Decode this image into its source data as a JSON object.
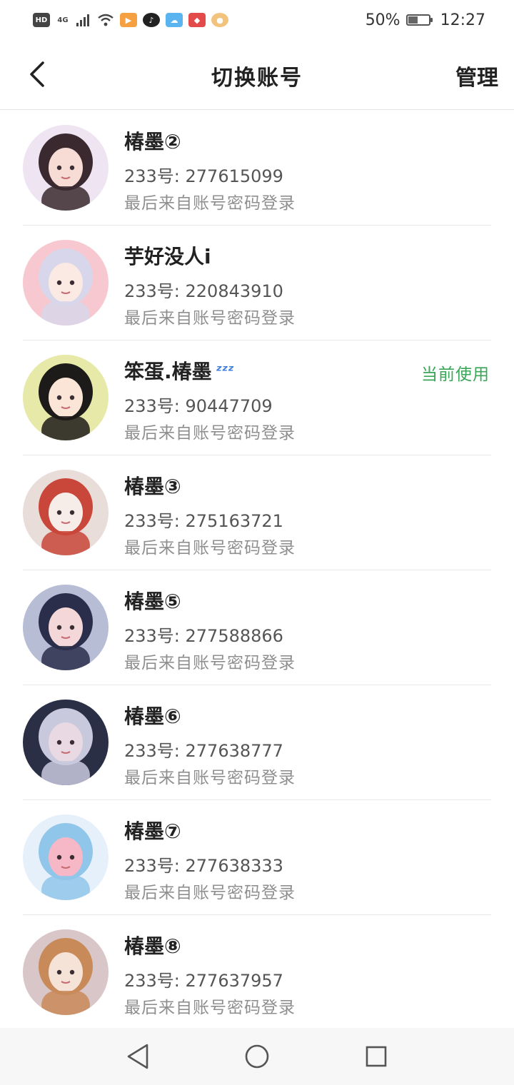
{
  "status_bar": {
    "hd": "HD",
    "network": "4G",
    "battery_text": "50%",
    "battery_level": 0.5,
    "time": "12:27"
  },
  "header": {
    "back_icon": "chevron-left-icon",
    "title": "切换账号",
    "manage_label": "管理"
  },
  "accounts": [
    {
      "name": "椿墨②",
      "id_line": "233号: 277615099",
      "login_line": "最后来自账号密码登录",
      "current": false,
      "palette": [
        "#efe5f2",
        "#3a2a2f",
        "#f7dcd6"
      ]
    },
    {
      "name": "芋好没人i",
      "id_line": "233号: 220843910",
      "login_line": "最后来自账号密码登录",
      "current": false,
      "palette": [
        "#f7c8cf",
        "#d8d6ea",
        "#fbe9e3"
      ]
    },
    {
      "name": "笨蛋.椿墨",
      "id_line": "233号: 90447709",
      "login_line": "最后来自账号密码登录",
      "current": true,
      "current_label": "当前使用",
      "zzz_icon": "zzz-icon",
      "palette": [
        "#e7e9a8",
        "#1d1a1a",
        "#fbe5d6"
      ]
    },
    {
      "name": "椿墨③",
      "id_line": "233号: 275163721",
      "login_line": "最后来自账号密码登录",
      "current": false,
      "palette": [
        "#e8ddd8",
        "#c9473a",
        "#f7ede8"
      ]
    },
    {
      "name": "椿墨⑤",
      "id_line": "233号: 277588866",
      "login_line": "最后来自账号密码登录",
      "current": false,
      "palette": [
        "#b8bdd6",
        "#2a2e4a",
        "#f3d7d9"
      ]
    },
    {
      "name": "椿墨⑥",
      "id_line": "233号: 277638777",
      "login_line": "最后来自账号密码登录",
      "current": false,
      "palette": [
        "#2b2f45",
        "#c9c9de",
        "#e8d9e3"
      ]
    },
    {
      "name": "椿墨⑦",
      "id_line": "233号: 277638333",
      "login_line": "最后来自账号密码登录",
      "current": false,
      "palette": [
        "#e6f0fb",
        "#8fc6ea",
        "#f6b7c7"
      ]
    },
    {
      "name": "椿墨⑧",
      "id_line": "233号: 277637957",
      "login_line": "最后来自账号密码登录",
      "current": false,
      "palette": [
        "#d9c6c8",
        "#c98a5a",
        "#f6e3d8"
      ]
    }
  ],
  "nav_bar": {
    "back": "triangle-back-icon",
    "home": "circle-home-icon",
    "recents": "square-recents-icon"
  }
}
